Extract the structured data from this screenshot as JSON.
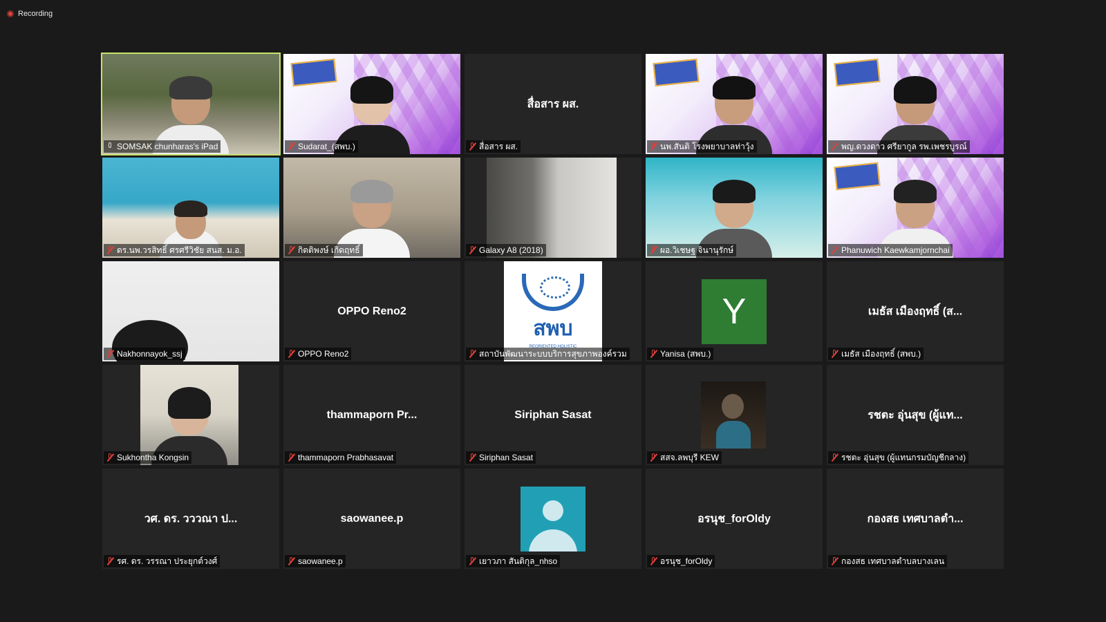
{
  "recording": {
    "label": "Recording"
  },
  "tiles": [
    {
      "label": "SOMSAK chunharas's iPad",
      "big": "",
      "active": true
    },
    {
      "label": "Sudarat_(สพบ.)",
      "big": ""
    },
    {
      "label": "สื่อสาร ผส.",
      "big": "สื่อสาร ผส."
    },
    {
      "label": "นพ.สันติ โรงพยาบาลท่าวุ้ง",
      "big": ""
    },
    {
      "label": "พญ.ดวงดาว ศรียากูล รพ.เพชรบูรณ์",
      "big": ""
    },
    {
      "label": "ดร.นพ.วรสิทธิ์ ศรศรีวิชัย สนส. ม.อ.",
      "big": ""
    },
    {
      "label": "กิตติพงษ์ เกิดฤทธิ์",
      "big": ""
    },
    {
      "label": "Galaxy A8 (2018)",
      "big": ""
    },
    {
      "label": "ผอ.วิเชษฐ จินานุรักษ์",
      "big": ""
    },
    {
      "label": "Phanuwich Kaewkamjornchai",
      "big": ""
    },
    {
      "label": "Nakhonnayok_ssj",
      "big": ""
    },
    {
      "label": "OPPO Reno2",
      "big": "OPPO Reno2"
    },
    {
      "label": "สถาบันพัฒนาระบบบริการสุขภาพองค์รวม",
      "big": "",
      "logo_text": "สพบ",
      "logo_sub": "REORIENTED HOLISTIC"
    },
    {
      "label": "Yanisa (สพบ.)",
      "big": "",
      "avatar_letter": "Y"
    },
    {
      "label": "เมธัส เมืองฤทธิ์ (สพบ.)",
      "big": "เมธัส เมืองฤทธิ์ (ส..."
    },
    {
      "label": "Sukhontha Kongsin",
      "big": ""
    },
    {
      "label": "thammaporn Prabhasavat",
      "big": "thammaporn  Pr..."
    },
    {
      "label": "Siriphan Sasat",
      "big": "Siriphan Sasat"
    },
    {
      "label": "สสจ.ลพบุรี KEW",
      "big": ""
    },
    {
      "label": "รชตะ อุ่นสุข (ผู้แทนกรมบัญชีกลาง)",
      "big": "รชตะ อุ่นสุข (ผู้แท..."
    },
    {
      "label": "รศ. ดร. วรรณา ประยุกต์วงศ์",
      "big": "วศ. ดร. วววณา ป..."
    },
    {
      "label": "saowanee.p",
      "big": "saowanee.p"
    },
    {
      "label": "เยาวภา สันติกุล_nhso",
      "big": ""
    },
    {
      "label": "อรนุช_forOldy",
      "big": "อรนุช_forOldy"
    },
    {
      "label": "กองสธ เทศบาลตำบลบางเลน",
      "big": "กองสธ เทศบาลตำ..."
    }
  ]
}
